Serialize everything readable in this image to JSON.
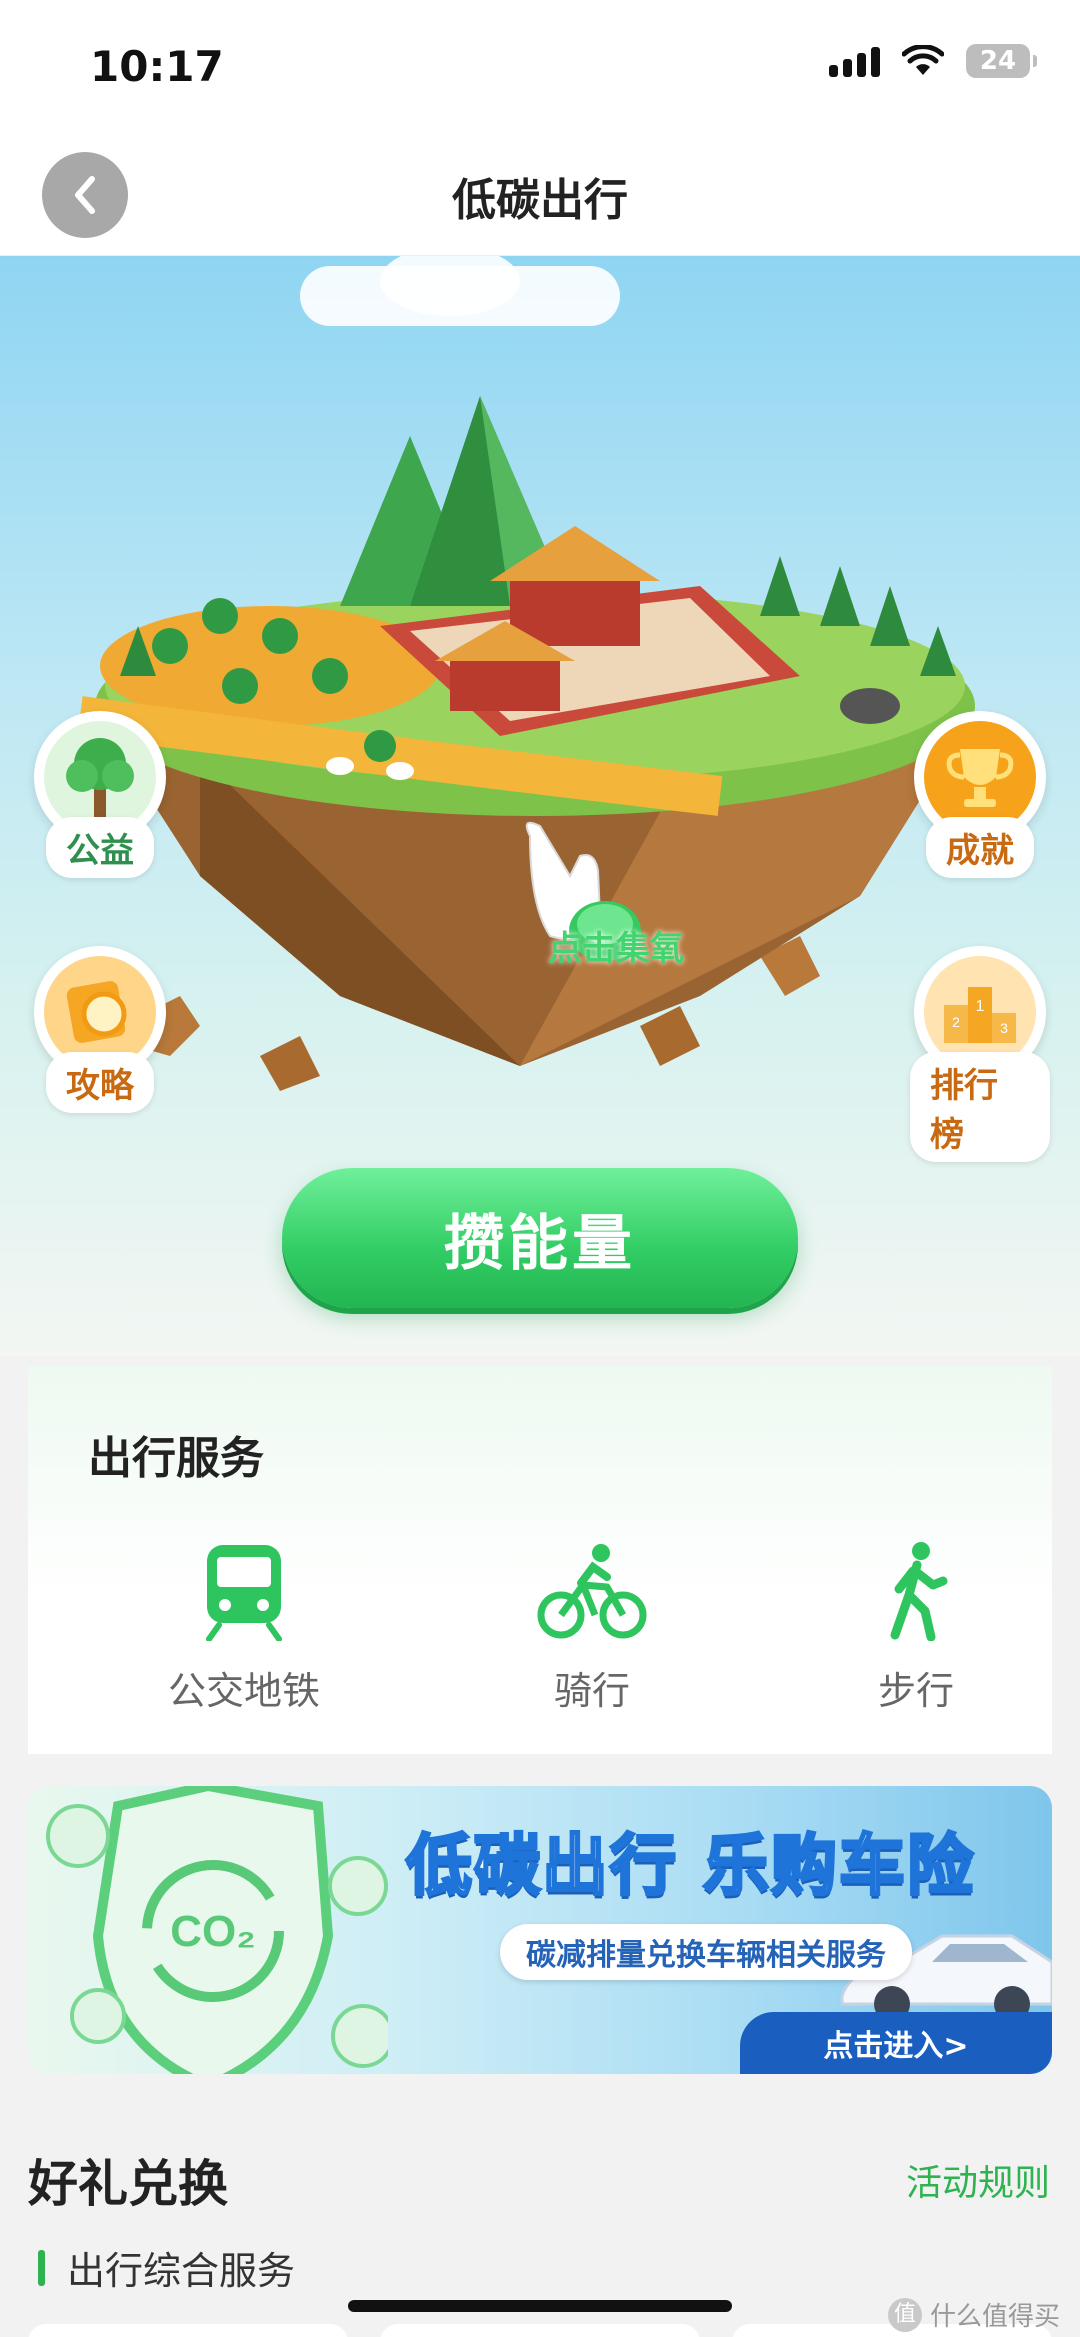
{
  "status_bar": {
    "time": "10:17",
    "battery": "24"
  },
  "nav": {
    "title": "低碳出行"
  },
  "hero": {
    "left_buttons": [
      {
        "label": "公益",
        "icon": "tree-icon"
      },
      {
        "label": "攻略",
        "icon": "guide-icon"
      }
    ],
    "right_buttons": [
      {
        "label": "成就",
        "icon": "trophy-icon"
      },
      {
        "label": "排行榜",
        "icon": "podium-icon"
      }
    ],
    "collect_hint": "点击集氧",
    "energy_button": "攒能量",
    "colors": {
      "accent": "#31cc63",
      "sky": "#8fd5f2"
    }
  },
  "services": {
    "title": "出行服务",
    "items": [
      {
        "label": "公交地铁",
        "icon": "subway-icon"
      },
      {
        "label": "骑行",
        "icon": "cycling-icon"
      },
      {
        "label": "步行",
        "icon": "walking-icon"
      }
    ]
  },
  "banner": {
    "badge": "CO₂",
    "title": "低碳出行 乐购车险",
    "subtitle": "碳减排量兑换车辆相关服务",
    "cta": "点击进入>"
  },
  "gifts": {
    "title": "好礼兑换",
    "rules": "活动规则",
    "subsection": "出行综合服务"
  },
  "watermark": {
    "icon": "值",
    "text": "什么值得买"
  }
}
